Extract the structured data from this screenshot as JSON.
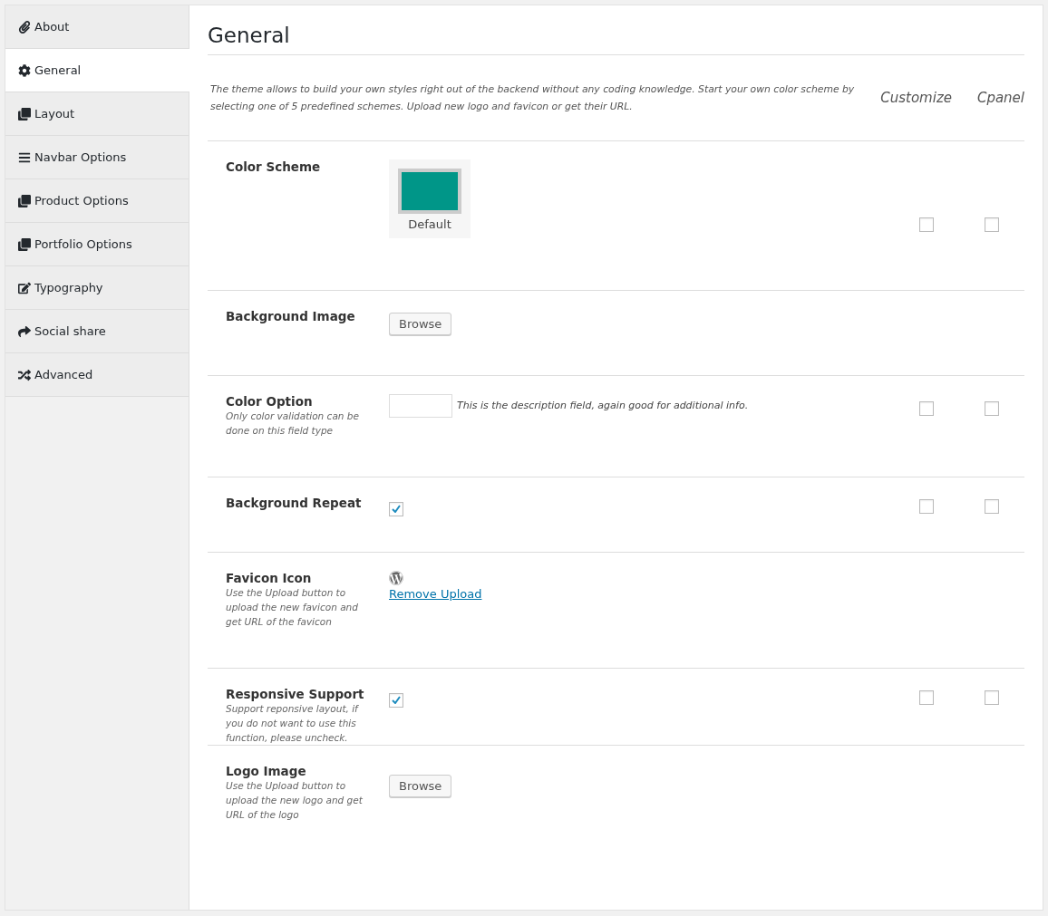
{
  "sidebar": {
    "items": [
      {
        "label": "About",
        "selected": false
      },
      {
        "label": "General",
        "selected": true
      },
      {
        "label": "Layout",
        "selected": false
      },
      {
        "label": "Navbar Options",
        "selected": false
      },
      {
        "label": "Product Options",
        "selected": false
      },
      {
        "label": "Portfolio Options",
        "selected": false
      },
      {
        "label": "Typography",
        "selected": false
      },
      {
        "label": "Social share",
        "selected": false
      },
      {
        "label": "Advanced",
        "selected": false
      }
    ]
  },
  "section": {
    "title": "General",
    "description": "The theme allows to build your own styles right out of the backend without any coding knowledge. Start your own color scheme by selecting one of 5 predefined schemes. Upload new logo and favicon or get their URL.",
    "column_headers": [
      "Customize",
      "Cpanel"
    ]
  },
  "rows": [
    {
      "kind": "scheme",
      "label": "Color Scheme",
      "swatch": {
        "name": "Default",
        "color": "#009688"
      },
      "customize": false,
      "cpanel": false
    },
    {
      "kind": "upload",
      "label": "Background Image",
      "button": "Browse"
    },
    {
      "kind": "color",
      "label": "Color Option",
      "help": "Only color validation can be done on this field type",
      "note": "This is the description field, again good for additional info.",
      "customize": false,
      "cpanel": false
    },
    {
      "kind": "checkbox",
      "label": "Background Repeat",
      "checked": true,
      "customize": false,
      "cpanel": false
    },
    {
      "kind": "favicon",
      "label": "Favicon Icon",
      "help": "Use the Upload button to upload the new favicon and get URL of the favicon",
      "link": "Remove Upload"
    },
    {
      "kind": "checkbox",
      "label": "Responsive Support",
      "help": "Support reponsive layout, if you do not want to use this function, please uncheck.",
      "checked": true,
      "customize": false,
      "cpanel": false
    },
    {
      "kind": "upload",
      "label": "Logo Image",
      "help": "Use the Upload button to upload the new logo and get URL of the logo",
      "button": "Browse"
    }
  ]
}
